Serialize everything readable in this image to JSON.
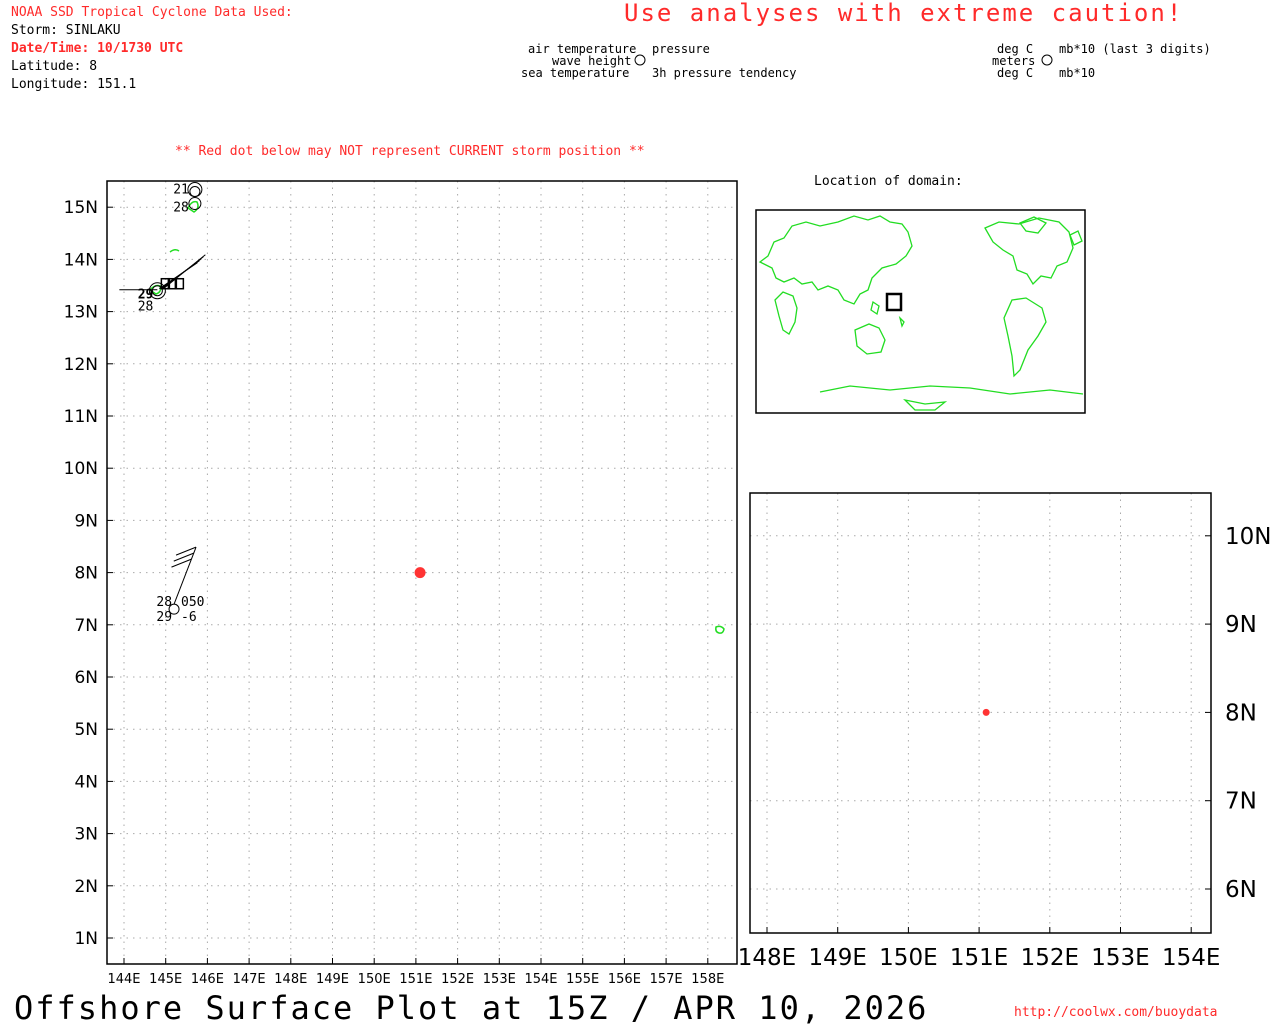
{
  "header": {
    "source": "NOAA SSD Tropical Cyclone Data Used:",
    "storm": "Storm: SINLAKU",
    "datetime": "Date/Time: 10/1730 UTC",
    "latitude": "Latitude: 8",
    "longitude": "Longitude: 151.1",
    "caution": "Use analyses with extreme caution!",
    "red_dot_note": "** Red dot below may NOT represent CURRENT storm position **"
  },
  "legend": {
    "left_labels": [
      "air temperature",
      "wave height",
      "sea temperature"
    ],
    "right_labels": [
      "pressure",
      "",
      "3h pressure tendency"
    ],
    "unit_left": [
      "deg C",
      "meters",
      "deg C"
    ],
    "unit_right": [
      "mb*10 (last 3 digits)",
      "",
      "mb*10"
    ]
  },
  "main_map": {
    "lon_labels": [
      "144E",
      "145E",
      "146E",
      "147E",
      "148E",
      "149E",
      "150E",
      "151E",
      "152E",
      "153E",
      "154E",
      "155E",
      "156E",
      "157E",
      "158E"
    ],
    "lat_labels": [
      "1N",
      "2N",
      "3N",
      "4N",
      "5N",
      "6N",
      "7N",
      "8N",
      "9N",
      "10N",
      "11N",
      "12N",
      "13N",
      "14N",
      "15N"
    ],
    "storm": {
      "lon": 151.1,
      "lat": 8.0,
      "color": "#ff3333"
    },
    "stations": [
      {
        "lon": 145.2,
        "lat": 7.3,
        "air_temp": "28",
        "sea_temp": "29",
        "pressure": "050",
        "tendency": "-6"
      },
      {
        "lon": 144.8,
        "lat": 13.4,
        "air_temp": "29",
        "sea_temp": "28",
        "pressure": "",
        "tendency": ""
      },
      {
        "lon": 145.7,
        "lat": 15.3,
        "air_temp": "21",
        "sea_temp": "28",
        "pressure": "",
        "tendency": ""
      }
    ],
    "land_color": "#22dd22"
  },
  "inset": {
    "title": "Location of domain:"
  },
  "zoom_map": {
    "lon_labels": [
      "148E",
      "149E",
      "150E",
      "151E",
      "152E",
      "153E",
      "154E"
    ],
    "lat_labels": [
      "6N",
      "7N",
      "8N",
      "9N",
      "10N"
    ],
    "storm": {
      "lon": 151.1,
      "lat": 8.0
    }
  },
  "footer": {
    "title": "Offshore Surface Plot at 15Z / APR 10, 2026",
    "url": "http://coolwx.com/buoydata"
  }
}
